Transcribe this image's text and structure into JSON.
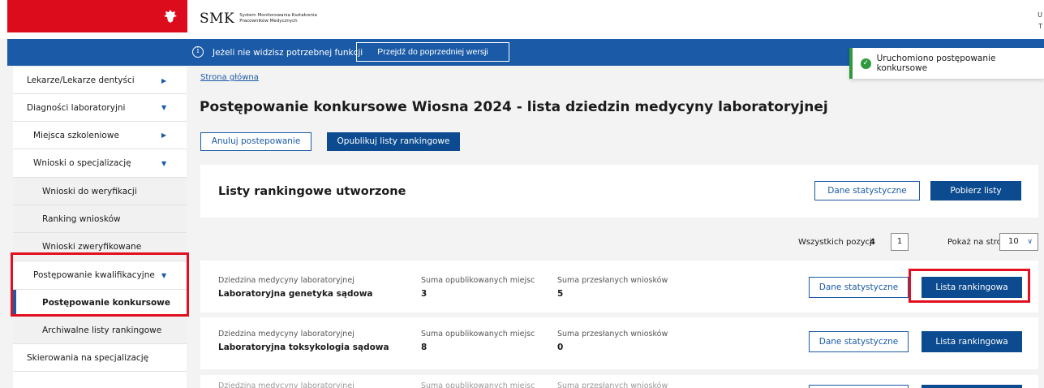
{
  "header": {
    "logo_main": "SMK",
    "logo_sub_line1": "System Monitorowania Kształcenia",
    "logo_sub_line2": "Pracowników Medycznych",
    "top_right_line1": "U",
    "top_right_line2": "T"
  },
  "infobar": {
    "text": "Jeżeli nie widzisz potrzebnej funkcji",
    "prev_version_button": "Przejdź do poprzedniej wersji"
  },
  "toast": {
    "text": "Uruchomiono postępowanie konkursowe"
  },
  "sidebar": {
    "items": [
      {
        "label": "Lekarze/Lekarze dentyści",
        "arrow": "▶"
      },
      {
        "label": "Diagności laboratoryjni",
        "arrow": "▼"
      },
      {
        "label": "Miejsca szkoleniowe",
        "arrow": "▶"
      },
      {
        "label": "Wnioski o specjalizację",
        "arrow": "▼"
      },
      {
        "label": "Wnioski do weryfikacji"
      },
      {
        "label": "Ranking wniosków"
      },
      {
        "label": "Wnioski zweryfikowane"
      },
      {
        "label": "Postępowanie kwalifikacyjne",
        "arrow": "▼"
      },
      {
        "label": "Postępowanie konkursowe"
      },
      {
        "label": "Archiwalne listy rankingowe"
      },
      {
        "label": "Skierowania na specjalizację"
      }
    ]
  },
  "main": {
    "breadcrumb": "Strona główna",
    "title": "Postępowanie konkursowe Wiosna 2024 - lista dziedzin medycyny laboratoryjnej",
    "cancel_button": "Anuluj postepowanie",
    "publish_button": "Opublikuj listy rankingowe",
    "lists_card": {
      "title": "Listy rankingowe utworzone",
      "stats_button": "Dane statystyczne",
      "download_button": "Pobierz listy"
    },
    "pager": {
      "total_label": "Wszystkich pozycji",
      "total_value": "4",
      "page": "1",
      "per_page_label": "Pokaż na stronie",
      "per_page_value": "10"
    },
    "columns": {
      "field": "Dziedzina medycyny laboratoryjnej",
      "published": "Suma opublikowanych miejsc",
      "submitted": "Suma przesłanych wniosków"
    },
    "rows": [
      {
        "field": "Laboratoryjna genetyka sądowa",
        "published": "3",
        "submitted": "5",
        "stats": "Dane statystyczne",
        "ranking": "Lista rankingowa"
      },
      {
        "field": "Laboratoryjna toksykologia sądowa",
        "published": "8",
        "submitted": "0",
        "stats": "Dane statystyczne",
        "ranking": "Lista rankingowa"
      }
    ],
    "partial_row": {
      "field": "Dziedzina medycyny laboratoryjnej",
      "published": "Suma opublikowanych miejsc",
      "submitted": "Suma przesłanych wniosków"
    }
  },
  "colors": {
    "accent_blue": "#1a5aa6",
    "dark_blue": "#0c4b8f",
    "brand_red": "#dc0c1c",
    "success_green": "#2f9a3c",
    "highlight_red": "#e01020"
  }
}
